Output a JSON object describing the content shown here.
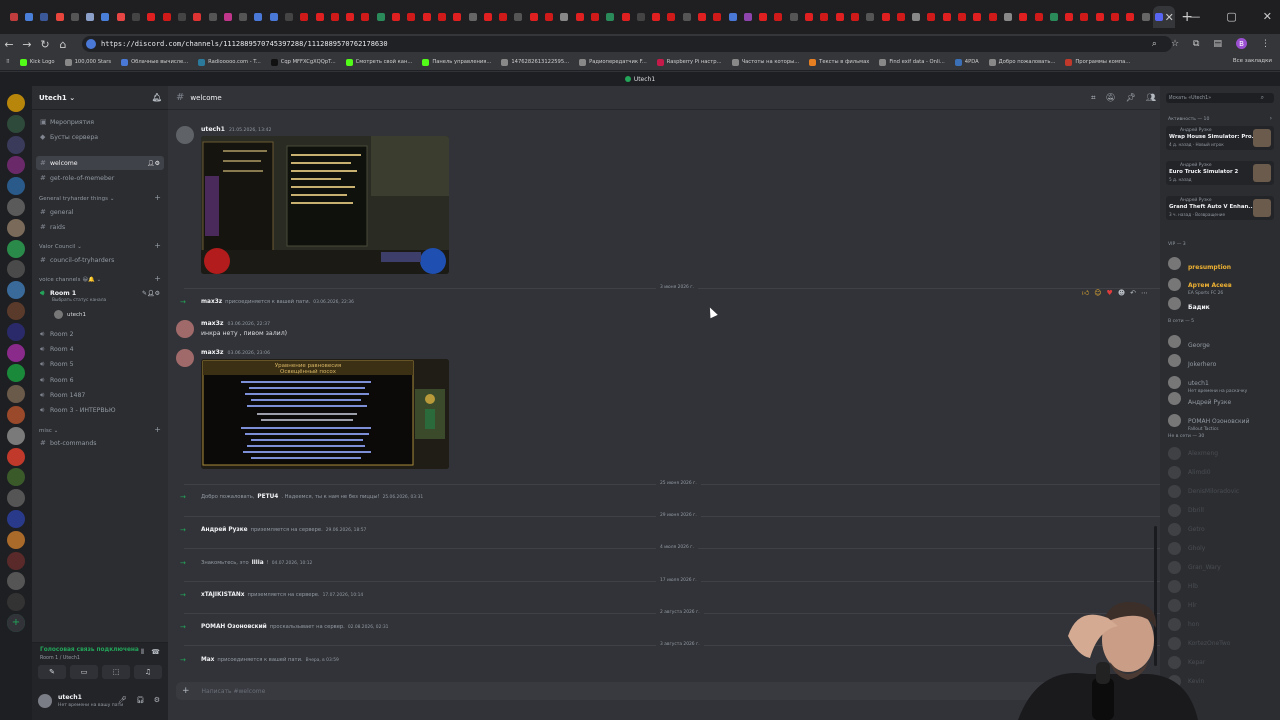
{
  "browser": {
    "url": "https://discord.com/channels/1112889570745397288/1112889570762178630",
    "tab_colors": [
      "#c13c3c",
      "#4a7fd9",
      "#3b5998",
      "#e8453c",
      "#555",
      "#8aa0c8",
      "#4a7fd9",
      "#e84545",
      "#444",
      "#e02020",
      "#d01a1a",
      "#444",
      "#d33",
      "#555",
      "#c0368b",
      "#555",
      "#4a78d6",
      "#4a78d6",
      "#444",
      "#d01a1a",
      "#e02020",
      "#d01a1a",
      "#e02020",
      "#d01a1a",
      "#2a8a5a",
      "#e02020",
      "#d01a1a",
      "#e02020",
      "#d01a1a",
      "#e02020",
      "#666",
      "#e02020",
      "#d01a1a",
      "#555",
      "#e02020",
      "#d01a1a",
      "#888",
      "#e02020",
      "#d01a1a",
      "#2a8a5a",
      "#e02020",
      "#444",
      "#e02020",
      "#d01a1a",
      "#555",
      "#e02020",
      "#d01a1a",
      "#4a78d6",
      "#8e44ad",
      "#e02020",
      "#d01a1a",
      "#555",
      "#e02020",
      "#d01a1a",
      "#e02020",
      "#d01a1a",
      "#555",
      "#e02020",
      "#d01a1a",
      "#888",
      "#d01a1a",
      "#e02020",
      "#d01a1a",
      "#e02020",
      "#d01a1a",
      "#888",
      "#e02020",
      "#d01a1a",
      "#2a8a5a",
      "#e02020",
      "#d01a1a",
      "#e02020",
      "#d01a1a",
      "#e02020",
      "#666"
    ],
    "bookmarks": [
      {
        "label": "Kick Logo",
        "color": "#53fc18"
      },
      {
        "label": "100,000 Stars",
        "color": "#888"
      },
      {
        "label": "Облачные вычисле...",
        "color": "#4a78d6"
      },
      {
        "label": "Radiooooo.com - T...",
        "color": "#2b7a9b"
      },
      {
        "label": "Cqp MFFXCgXQQpT...",
        "color": "#111"
      },
      {
        "label": "Смотреть свой кан...",
        "color": "#53fc18"
      },
      {
        "label": "Панель управления...",
        "color": "#53fc18"
      },
      {
        "label": "1476282613122595...",
        "color": "#888"
      },
      {
        "label": "Радиопередатчик F...",
        "color": "#888"
      },
      {
        "label": "Raspberry Pi настр...",
        "color": "#c51a4a"
      },
      {
        "label": "Частоты на которы...",
        "color": "#888"
      },
      {
        "label": "Тексты в фильмах",
        "color": "#e67e22"
      },
      {
        "label": "Find exif data - Onli...",
        "color": "#888"
      },
      {
        "label": "4PDA",
        "color": "#3b6fb6"
      },
      {
        "label": "Добро пожаловать...",
        "color": "#888"
      },
      {
        "label": "Программы компа...",
        "color": "#c0392b"
      }
    ],
    "bookmarks_all": "Все закладки"
  },
  "top_strip": {
    "title": "Utech1"
  },
  "server": {
    "name": "Utech1 ⌄"
  },
  "sidebar": {
    "events": "Мероприятия",
    "boosts": "Бусты сервера",
    "channels": [
      {
        "label": "welcome"
      },
      {
        "label": "get-role-of-memeber"
      }
    ],
    "cat_general": "General tryharder things ⌄",
    "general_channels": [
      {
        "label": "general"
      },
      {
        "label": "raids"
      }
    ],
    "cat_valor": "Valor Council ⌄",
    "valor_channels": [
      {
        "label": "council-of-tryharders"
      }
    ],
    "cat_voice": "voice channels 😀🔔 ⌄",
    "voice": [
      {
        "label": "Room 1",
        "sub": "Выбрать статус канала"
      },
      {
        "label": "Room 2"
      },
      {
        "label": "Room 4"
      },
      {
        "label": "Room 5"
      },
      {
        "label": "Room 6"
      },
      {
        "label": "Room 1487"
      },
      {
        "label": "Room 3 - ИНТЕРВЬЮ"
      }
    ],
    "voice_user": "utech1",
    "cat_misc": "misc ⌄",
    "misc_channels": [
      {
        "label": "bot-commands"
      }
    ],
    "vc_status": "Голосовая связь подключена",
    "vc_sub": "Room 1 / Utech1",
    "user": {
      "name": "utech1",
      "status": "Нет времени на вашу пати"
    }
  },
  "channel": {
    "name": "welcome"
  },
  "messages": [
    {
      "author": "utech1",
      "time": "21.05.2026, 13:42",
      "text": ""
    },
    {
      "author": "max3z",
      "time": "03.06.2026, 22:37",
      "text": "инкра нету , пивом залил)"
    },
    {
      "author": "max3z",
      "time": "03.06.2026, 23:06",
      "text": ""
    }
  ],
  "screenshot_text": [
    "Уравнение равновесия",
    "Освещённый посох"
  ],
  "system": [
    {
      "name": "max3z",
      "text": "присоединяется к вашей пати.",
      "time": "03.06.2026, 22:36"
    },
    {
      "pre": "Добро пожаловать,",
      "name": "PETU4",
      "text": ". Надеемся, ты к нам не без пиццы!",
      "time": "25.06.2026, 03:31"
    },
    {
      "name": "Андрей Рузке",
      "text": "приземляется на сервере.",
      "time": "29.06.2026, 18:57"
    },
    {
      "pre": "Знакомьтесь, это",
      "name": "Illia",
      "text": "!",
      "time": "04.07.2026, 10:12"
    },
    {
      "name": "xTAJIKISTANx",
      "text": "приземляется на сервере.",
      "time": "17.07.2026, 10:14"
    },
    {
      "name": "РОМАН Озоновский",
      "text": "проскальзывает на сервер.",
      "time": "02.08.2026, 02:31"
    },
    {
      "name": "Max",
      "text": "присоединяется к вашей пати.",
      "time": "Вчера, в 03:59"
    }
  ],
  "dates": [
    "3 июня 2026 г.",
    "25 июня 2026 г.",
    "29 июня 2026 г.",
    "4 июля 2026 г.",
    "17 июля 2026 г.",
    "2 августа 2026 г.",
    "3 августа 2026 г."
  ],
  "composer": {
    "placeholder": "Написать #welcome"
  },
  "members": {
    "search": "Искать «Utech1»",
    "activity_title": "Активность — 10",
    "activities": [
      {
        "user": "Андрей Рузке",
        "game": "Wrap House Simulator: Pro...",
        "time": "4 д. назад · Новый игрок"
      },
      {
        "user": "Андрей Рузке",
        "game": "Euro Truck Simulator 2",
        "time": "5 д. назад"
      },
      {
        "user": "Андрей Рузке",
        "game": "Grand Theft Auto V Enhan...",
        "time": "3 ч. назад · Возвращение"
      }
    ],
    "vip_title": "VIP — 3",
    "vip": [
      {
        "name": "presumption",
        "sub": "",
        "color": "#f0b232"
      },
      {
        "name": "Артем Асеев",
        "sub": "EA Sports FC 26",
        "color": "#f0b232"
      },
      {
        "name": "Бадик",
        "sub": "",
        "color": "#f2f3f5"
      }
    ],
    "online_title": "В сети — 5",
    "online": [
      {
        "name": "George",
        "sub": ""
      },
      {
        "name": "Jokerhero",
        "sub": ""
      },
      {
        "name": "utech1",
        "sub": "Нет времени на раскачку"
      },
      {
        "name": "Андрей Рузке",
        "sub": ""
      },
      {
        "name": "РОМАН Озоновский",
        "sub": "Fallout Tactics"
      }
    ],
    "offline_title": "Не в сети — 30",
    "offline": [
      "Alexmeng",
      "Alimdi0",
      "DenisMiloradovic",
      "Dbrill",
      "Getro",
      "Gholy",
      "Gran_Wary",
      "Hlb",
      "Hlr",
      "hon",
      "KortezOneTwo",
      "Kepar",
      "Kevin"
    ]
  }
}
